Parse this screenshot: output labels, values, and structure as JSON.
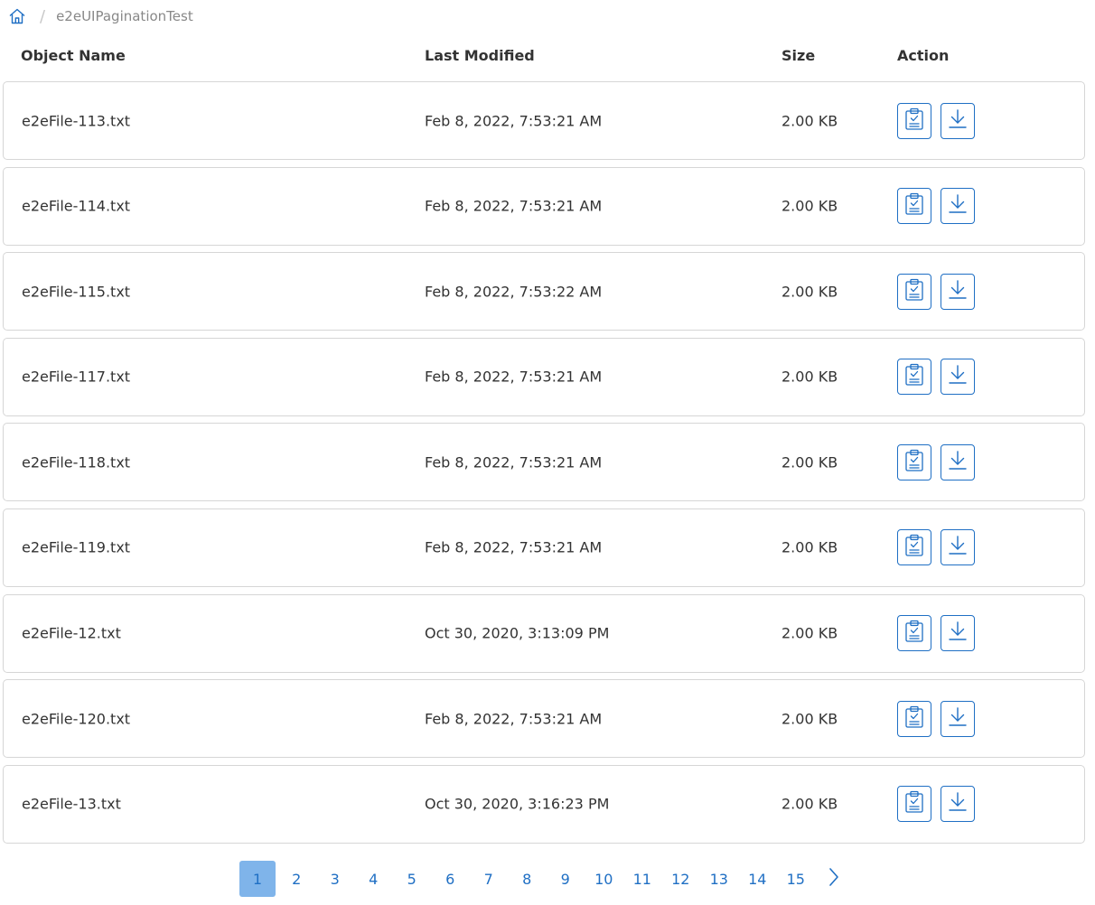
{
  "breadcrumb": {
    "home_icon": "home-icon",
    "separator": "/",
    "current": "e2eUIPaginationTest"
  },
  "table": {
    "headers": {
      "name": "Object Name",
      "modified": "Last Modified",
      "size": "Size",
      "action": "Action"
    },
    "rows": [
      {
        "name": "e2eFile-113.txt",
        "modified": "Feb 8, 2022, 7:53:21 AM",
        "size": "2.00 KB"
      },
      {
        "name": "e2eFile-114.txt",
        "modified": "Feb 8, 2022, 7:53:21 AM",
        "size": "2.00 KB"
      },
      {
        "name": "e2eFile-115.txt",
        "modified": "Feb 8, 2022, 7:53:22 AM",
        "size": "2.00 KB"
      },
      {
        "name": "e2eFile-117.txt",
        "modified": "Feb 8, 2022, 7:53:21 AM",
        "size": "2.00 KB"
      },
      {
        "name": "e2eFile-118.txt",
        "modified": "Feb 8, 2022, 7:53:21 AM",
        "size": "2.00 KB"
      },
      {
        "name": "e2eFile-119.txt",
        "modified": "Feb 8, 2022, 7:53:21 AM",
        "size": "2.00 KB"
      },
      {
        "name": "e2eFile-12.txt",
        "modified": "Oct 30, 2020, 3:13:09 PM",
        "size": "2.00 KB"
      },
      {
        "name": "e2eFile-120.txt",
        "modified": "Feb 8, 2022, 7:53:21 AM",
        "size": "2.00 KB"
      },
      {
        "name": "e2eFile-13.txt",
        "modified": "Oct 30, 2020, 3:16:23 PM",
        "size": "2.00 KB"
      }
    ],
    "row_actions": [
      "clipboard-check-icon",
      "download-icon"
    ]
  },
  "pagination": {
    "pages": [
      "1",
      "2",
      "3",
      "4",
      "5",
      "6",
      "7",
      "8",
      "9",
      "10",
      "11",
      "12",
      "13",
      "14",
      "15"
    ],
    "active_page": "1",
    "next_icon": "chevron-right-icon"
  },
  "colors": {
    "accent": "#1f6fc4",
    "active_page_bg": "#7fb4ea",
    "row_border": "#d6d6d6",
    "text": "#333333",
    "muted": "#888888"
  }
}
